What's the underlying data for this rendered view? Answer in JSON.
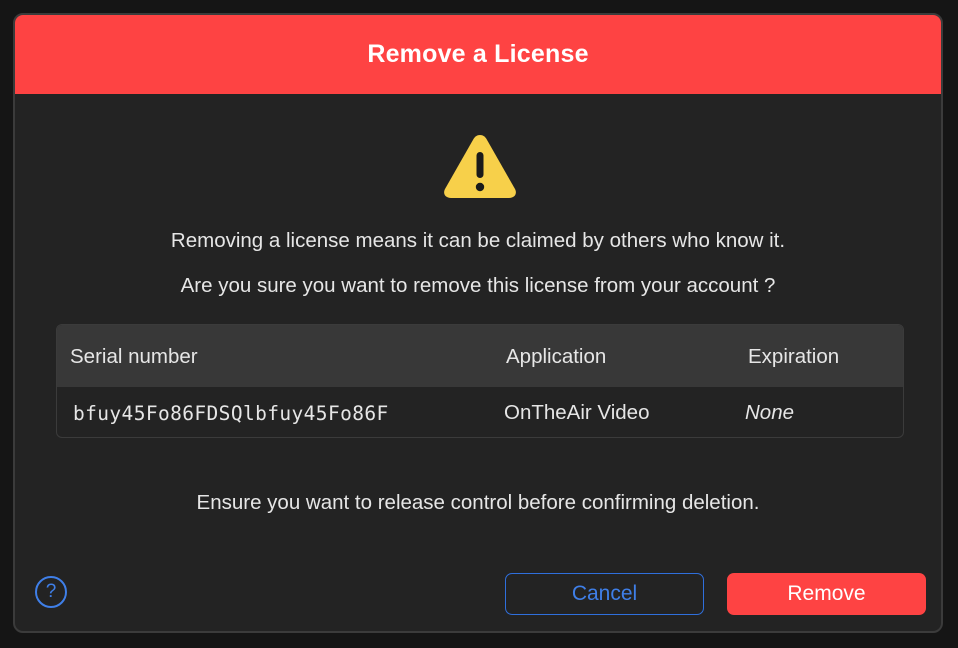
{
  "dialog": {
    "title": "Remove a License",
    "icon": "warning-icon",
    "message_line1": "Removing a license means it can be claimed by others who know it.",
    "message_line2": "Are you sure you want to remove this license from your account ?",
    "footer_message": "Ensure you want to release control before confirming deletion."
  },
  "table": {
    "headers": [
      "Serial number",
      "Application",
      "Expiration"
    ],
    "rows": [
      [
        "bfuy45Fo86FDSQlbfuy45Fo86F",
        "OnTheAir Video",
        "None"
      ]
    ]
  },
  "buttons": {
    "help_label": "?",
    "cancel_label": "Cancel",
    "remove_label": "Remove"
  },
  "colors": {
    "accent_red": "#fe4343",
    "accent_blue": "#3f7fe8",
    "warning_yellow": "#f7d04a",
    "background": "#232323"
  }
}
